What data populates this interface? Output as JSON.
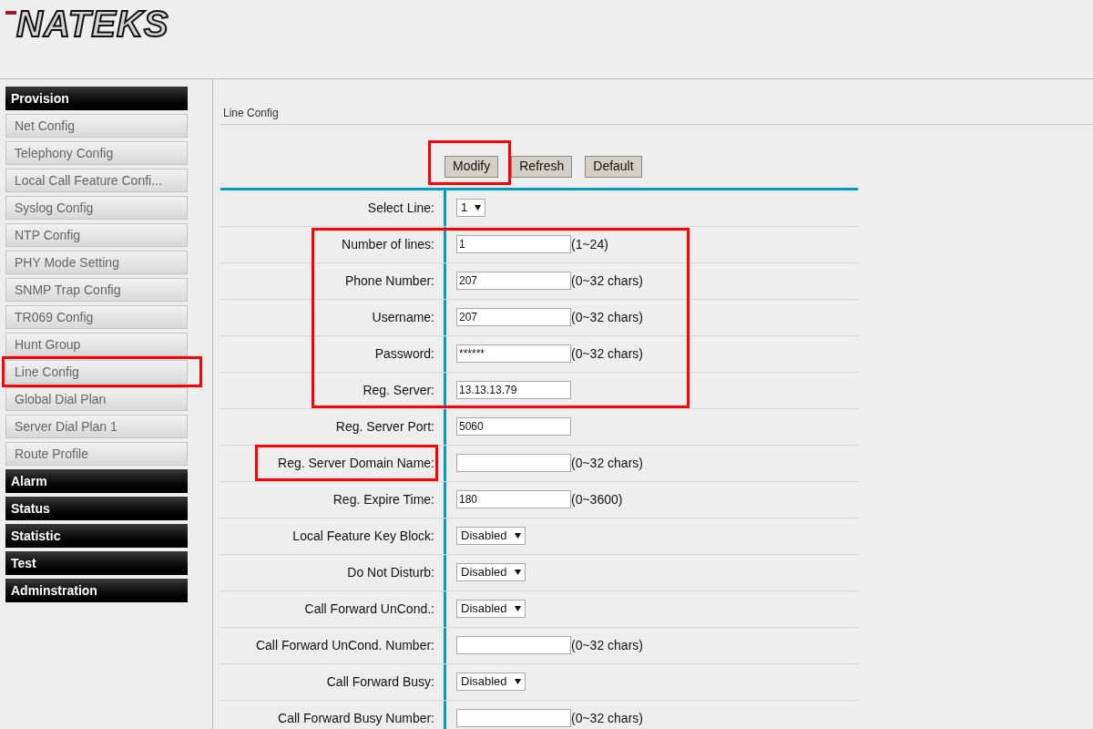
{
  "logo": "NATEKS",
  "sidebar": [
    {
      "title": "Provision",
      "items": [
        {
          "label": "Net Config",
          "annotated": false
        },
        {
          "label": "Telephony Config",
          "annotated": false
        },
        {
          "label": "Local Call Feature Confi...",
          "annotated": false
        },
        {
          "label": "Syslog Config",
          "annotated": false
        },
        {
          "label": "NTP Config",
          "annotated": false
        },
        {
          "label": "PHY Mode Setting",
          "annotated": false
        },
        {
          "label": "SNMP Trap Config",
          "annotated": false
        },
        {
          "label": "TR069 Config",
          "annotated": false
        },
        {
          "label": "Hunt Group",
          "annotated": false
        },
        {
          "label": "Line Config",
          "annotated": true
        },
        {
          "label": "Global Dial Plan",
          "annotated": false
        },
        {
          "label": "Server Dial Plan 1",
          "annotated": false
        },
        {
          "label": "Route Profile",
          "annotated": false
        }
      ]
    },
    {
      "title": "Alarm"
    },
    {
      "title": "Status"
    },
    {
      "title": "Statistic"
    },
    {
      "title": "Test"
    },
    {
      "title": "Adminstration"
    }
  ],
  "page_title": "Line Config",
  "buttons": [
    {
      "label": "Modify",
      "annotated": true
    },
    {
      "label": "Refresh",
      "annotated": false
    },
    {
      "label": "Default",
      "annotated": false
    }
  ],
  "fields": [
    {
      "label": "Select Line:",
      "kind": "select",
      "value": "1",
      "in_frame": false,
      "label_framed": false
    },
    {
      "label": "Number of lines:",
      "kind": "input",
      "value": "1",
      "hint": "(1~24)",
      "in_frame": true,
      "label_framed": false
    },
    {
      "label": "Phone Number:",
      "kind": "input",
      "value": "207",
      "hint": "(0~32 chars)",
      "in_frame": true,
      "label_framed": false
    },
    {
      "label": "Username:",
      "kind": "input",
      "value": "207",
      "hint": "(0~32 chars)",
      "in_frame": true,
      "label_framed": false
    },
    {
      "label": "Password:",
      "kind": "input",
      "value": "******",
      "hint": "(0~32 chars)",
      "in_frame": true,
      "label_framed": false
    },
    {
      "label": "Reg. Server:",
      "kind": "input",
      "value": "13.13.13.79",
      "in_frame": true,
      "label_framed": false
    },
    {
      "label": "Reg. Server Port:",
      "kind": "input",
      "value": "5060",
      "in_frame": false,
      "label_framed": false
    },
    {
      "label": "Reg. Server Domain Name:",
      "kind": "input",
      "hint": "(0~32 chars)",
      "in_frame": false,
      "label_framed": true
    },
    {
      "label": "Reg. Expire Time:",
      "kind": "input",
      "value": "180",
      "hint": "(0~3600)",
      "in_frame": false,
      "label_framed": false
    },
    {
      "label": "Local Feature Key Block:",
      "kind": "select",
      "value": "Disabled",
      "in_frame": false,
      "label_framed": false
    },
    {
      "label": "Do Not Disturb:",
      "kind": "select",
      "value": "Disabled",
      "in_frame": false,
      "label_framed": false
    },
    {
      "label": "Call Forward UnCond.:",
      "kind": "select",
      "value": "Disabled",
      "in_frame": false,
      "label_framed": false
    },
    {
      "label": "Call Forward UnCond. Number:",
      "kind": "input",
      "hint": "(0~32 chars)",
      "in_frame": false,
      "label_framed": false
    },
    {
      "label": "Call Forward Busy:",
      "kind": "select",
      "value": "Disabled",
      "in_frame": false,
      "label_framed": false
    },
    {
      "label": "Call Forward Busy Number:",
      "kind": "input",
      "hint": "(0~32 chars)",
      "in_frame": false,
      "label_framed": false
    }
  ]
}
